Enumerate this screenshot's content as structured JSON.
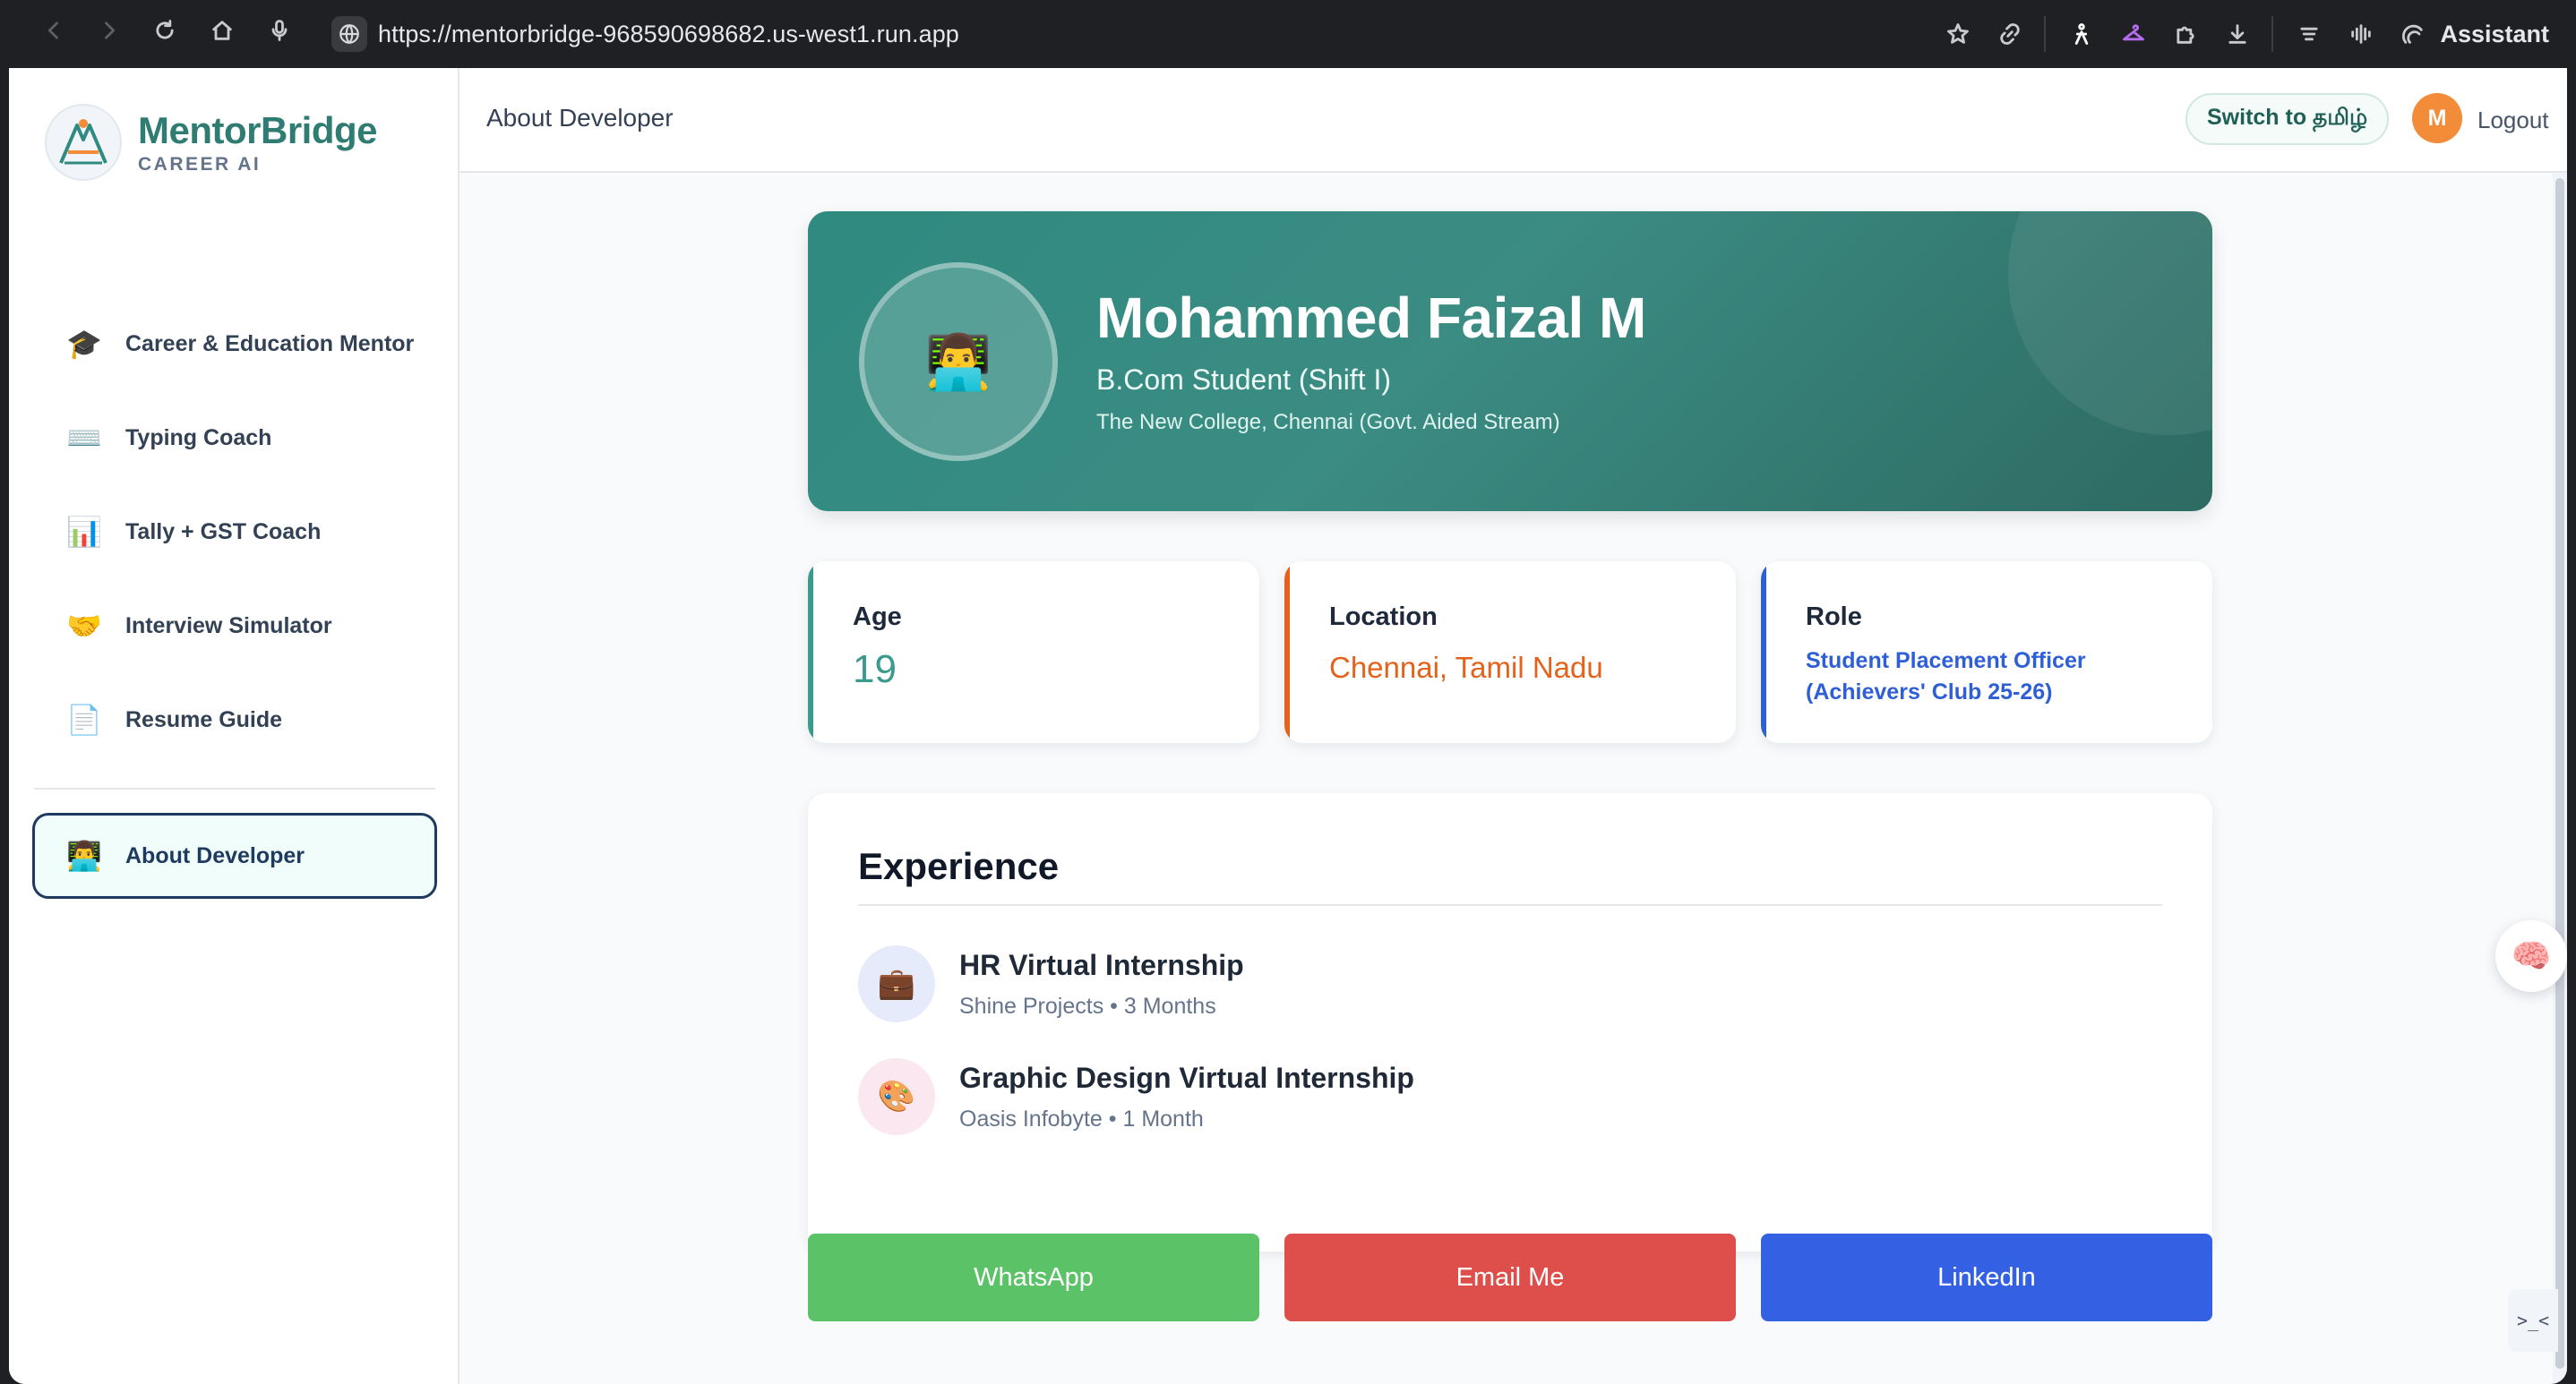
{
  "browser": {
    "url": "https://mentorbridge-968590698682.us-west1.run.app",
    "assistant_label": "Assistant"
  },
  "brand": {
    "name": "MentorBridge",
    "subtitle": "CAREER AI"
  },
  "sidebar": {
    "items": [
      {
        "icon": "🎓",
        "label": "Career & Education Mentor"
      },
      {
        "icon": "⌨️",
        "label": "Typing Coach"
      },
      {
        "icon": "📊",
        "label": "Tally + GST Coach"
      },
      {
        "icon": "🤝",
        "label": "Interview Simulator"
      },
      {
        "icon": "📄",
        "label": "Resume Guide"
      }
    ],
    "active": {
      "icon": "👨‍💻",
      "label": "About Developer"
    }
  },
  "header": {
    "title": "About Developer",
    "language_button": "Switch to தமிழ்",
    "avatar_initial": "M",
    "logout_label": "Logout"
  },
  "profile": {
    "avatar": "👨‍💻",
    "name": "Mohammed Faizal M",
    "role": "B.Com Student (Shift I)",
    "college": "The New College, Chennai (Govt. Aided Stream)"
  },
  "stats": [
    {
      "label": "Age",
      "value": "19",
      "color": "#3a9a8b"
    },
    {
      "label": "Location",
      "value": "Chennai, Tamil Nadu",
      "color": "#e4621b"
    },
    {
      "label": "Role",
      "value": "Student Placement Officer (Achievers' Club 25-26)",
      "color": "#2f5fd6"
    }
  ],
  "experience": {
    "title": "Experience",
    "items": [
      {
        "icon": "💼",
        "title": "HR Virtual Internship",
        "company": "Shine Projects",
        "duration": "3 Months",
        "icon_bg": "#e6ebfb"
      },
      {
        "icon": "🎨",
        "title": "Graphic Design Virtual Internship",
        "company": "Oasis Infobyte",
        "duration": "1 Month",
        "icon_bg": "#fbe7f0"
      }
    ]
  },
  "contacts": [
    {
      "label": "WhatsApp",
      "color": "#5cc268"
    },
    {
      "label": "Email Me",
      "color": "#de4e4a"
    },
    {
      "label": "LinkedIn",
      "color": "#3461e3"
    }
  ],
  "floating": {
    "brain_icon": "🧠",
    "code_icon": ">_<"
  }
}
